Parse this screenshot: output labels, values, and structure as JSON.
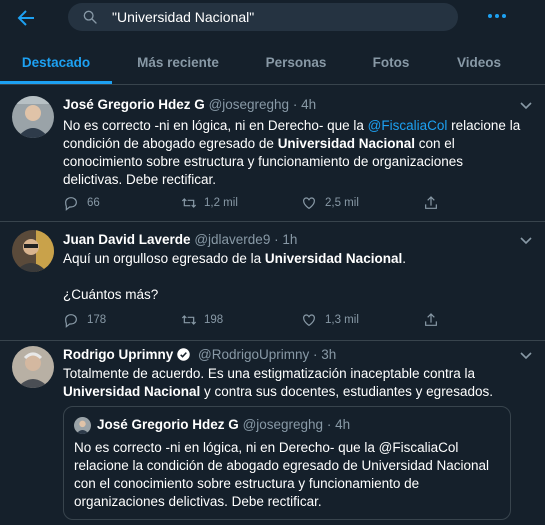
{
  "search": {
    "query": "\"Universidad Nacional\""
  },
  "tabs": [
    {
      "label": "Destacado",
      "active": true
    },
    {
      "label": "Más reciente",
      "active": false
    },
    {
      "label": "Personas",
      "active": false
    },
    {
      "label": "Fotos",
      "active": false
    },
    {
      "label": "Videos",
      "active": false
    }
  ],
  "colors": {
    "accent": "#1da1f2",
    "background": "#15202b",
    "muted": "#8899a6",
    "border": "#38444d"
  },
  "tweets": [
    {
      "name": "José Gregorio Hdez G",
      "handle": "@josegreghg",
      "time": "· 4h",
      "body": {
        "t1": "No es correcto -ni en lógica, ni en Derecho- que la ",
        "mention": "@FiscaliaCol",
        "t2": " relacione la condición de abogado egresado de ",
        "bold": "Universidad Nacional",
        "t3": " con el conocimiento sobre estructura y funcionamiento de organizaciones delictivas. Debe rectificar."
      },
      "replies": "66",
      "retweets": "1,2 mil",
      "likes": "2,5 mil"
    },
    {
      "name": "Juan David Laverde",
      "handle": "@jdlaverde9",
      "time": "· 1h",
      "body": {
        "t1": "Aquí un orgulloso egresado de la ",
        "bold": "Universidad Nacional",
        "t2": ".",
        "t3": "¿Cuántos más?"
      },
      "replies": "178",
      "retweets": "198",
      "likes": "1,3 mil"
    },
    {
      "name": "Rodrigo Uprimny",
      "handle": "@RodrigoUprimny",
      "time": "· 3h",
      "body": {
        "t1": "Totalmente de acuerdo. Es una estigmatización inaceptable contra la ",
        "bold": "Universidad Nacional",
        "t2": " y contra sus docentes, estudiantes y egresados."
      },
      "quote": {
        "name": "José Gregorio Hdez G",
        "handle": "@josegreghg",
        "time": "· 4h",
        "body": "No es correcto -ni en lógica, ni en Derecho- que la @FiscaliaCol relacione la condición de abogado egresado de Universidad Nacional con el conocimiento sobre estructura y funcionamiento de organizaciones delictivas. Debe rectificar."
      }
    }
  ]
}
